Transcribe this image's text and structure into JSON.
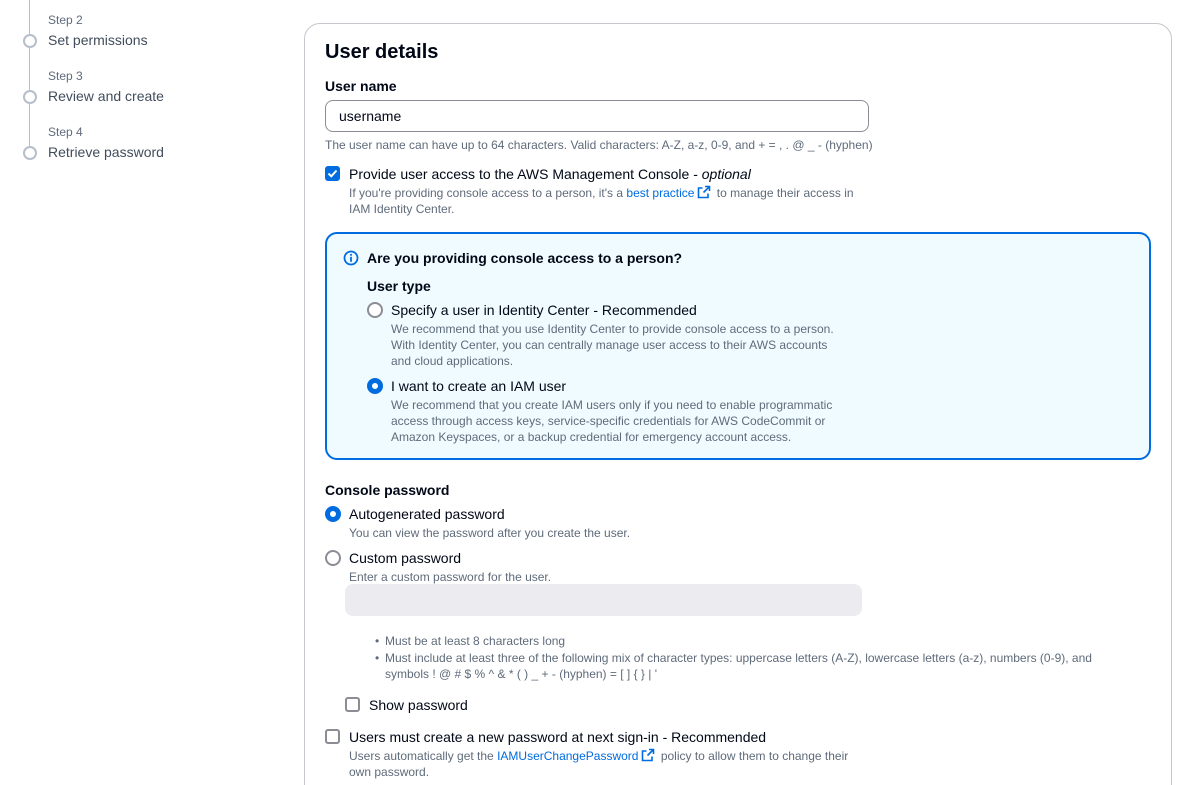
{
  "steps": [
    {
      "label": "Step 2",
      "title": "Set permissions"
    },
    {
      "label": "Step 3",
      "title": "Review and create"
    },
    {
      "label": "Step 4",
      "title": "Retrieve password"
    }
  ],
  "user_details": {
    "heading": "User details",
    "username_label": "User name",
    "username_value": "username",
    "username_hint": "The user name can have up to 64 characters. Valid characters: A-Z, a-z, 0-9, and + = , . @ _ - (hyphen)",
    "console_access": {
      "checked": true,
      "label": "Provide user access to the AWS Management Console - ",
      "label_optional": "optional",
      "desc_before": "If you're providing console access to a person, it's a ",
      "desc_link": "best practice",
      "desc_after_line1": " to manage their access in",
      "desc_line2": "IAM Identity Center."
    }
  },
  "info_box": {
    "title": "Are you providing console access to a person?",
    "user_type_label": "User type",
    "options": [
      {
        "label": "Specify a user in Identity Center - Recommended",
        "selected": false,
        "desc": [
          "We recommend that you use Identity Center to provide console access to a person.",
          "With Identity Center, you can centrally manage user access to their AWS accounts",
          "and cloud applications."
        ]
      },
      {
        "label": "I want to create an IAM user",
        "selected": true,
        "desc": [
          "We recommend that you create IAM users only if you need to enable programmatic",
          "access through access keys, service-specific credentials for AWS CodeCommit or",
          "Amazon Keyspaces, or a backup credential for emergency account access."
        ]
      }
    ]
  },
  "console_password": {
    "label": "Console password",
    "options": [
      {
        "label": "Autogenerated password",
        "desc": "You can view the password after you create the user.",
        "selected": true
      },
      {
        "label": "Custom password",
        "desc": "Enter a custom password for the user.",
        "selected": false
      }
    ],
    "password_placeholder": "",
    "rules": [
      "Must be at least 8 characters long",
      "Must include at least three of the following mix of character types: uppercase letters (A-Z), lowercase letters (a-z), numbers (0-9), and",
      "symbols ! @ # $ % ^ & * ( ) _ + - (hyphen) = [ ] { } | '"
    ],
    "show_password_label": "Show password",
    "show_password_checked": false
  },
  "reset_password": {
    "checked": false,
    "label": "Users must create a new password at next sign-in - Recommended",
    "desc_before": "Users automatically get the ",
    "desc_link": "IAMUserChangePassword",
    "desc_after_line1": " policy to allow them to change their",
    "desc_line2": "own password."
  },
  "colors": {
    "accent": "#006ce0",
    "info_bg": "#f0fbff",
    "text": "#000716",
    "muted": "#5f6b7a"
  }
}
